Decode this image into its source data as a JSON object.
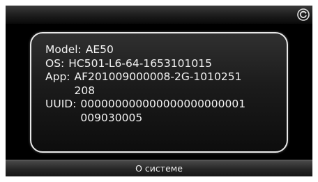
{
  "header": {
    "refresh_icon": "refresh-icon"
  },
  "info": {
    "model_label": "Model:",
    "model_value": "AE50",
    "os_label": "OS:",
    "os_value": "HC501-L6-64-1653101015",
    "app_label": "App:",
    "app_value": "AF201009000008-2G-1010251\n208",
    "uuid_label": "UUID:",
    "uuid_value": "000000000000000000000001\n009030005"
  },
  "footer": {
    "title": "О системе"
  },
  "colors": {
    "panel_border": "#e8e8e8",
    "text": "#f2f2f2",
    "background": "#000000"
  }
}
